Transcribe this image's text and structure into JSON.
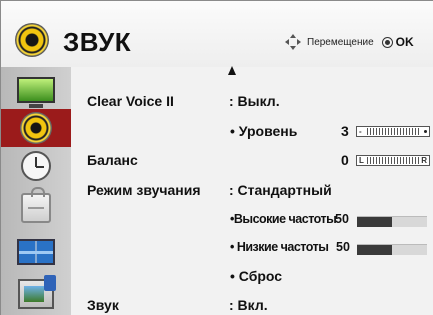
{
  "header": {
    "title": "ЗВУК",
    "nav_hint": "Перемещение",
    "ok_label": "OK"
  },
  "sidebar": {
    "items": [
      {
        "icon": "picture-icon",
        "active": false
      },
      {
        "icon": "sound-icon",
        "active": true
      },
      {
        "icon": "time-icon",
        "active": false
      },
      {
        "icon": "lock-icon",
        "active": false
      },
      {
        "icon": "option-icon",
        "active": false
      },
      {
        "icon": "my-media-icon",
        "active": false
      }
    ]
  },
  "menu": {
    "clear_voice": {
      "label": "Clear Voice II",
      "value": ": Выкл."
    },
    "level": {
      "label": "• Уровень",
      "value": "3"
    },
    "balance": {
      "label": "Баланс",
      "value": "0"
    },
    "sound_mode": {
      "label": "Режим звучания",
      "value": ": Стандартный"
    },
    "treble": {
      "label": "•Высокие частоты",
      "value": "50"
    },
    "bass": {
      "label": "• Низкие частоты",
      "value": "50"
    },
    "reset": {
      "label": "• Сброс"
    },
    "sound": {
      "label": "Звук",
      "value": ": Вкл."
    }
  },
  "colors": {
    "active_item": "#9b1b1b",
    "bar_fill": "#3a3a3a"
  }
}
